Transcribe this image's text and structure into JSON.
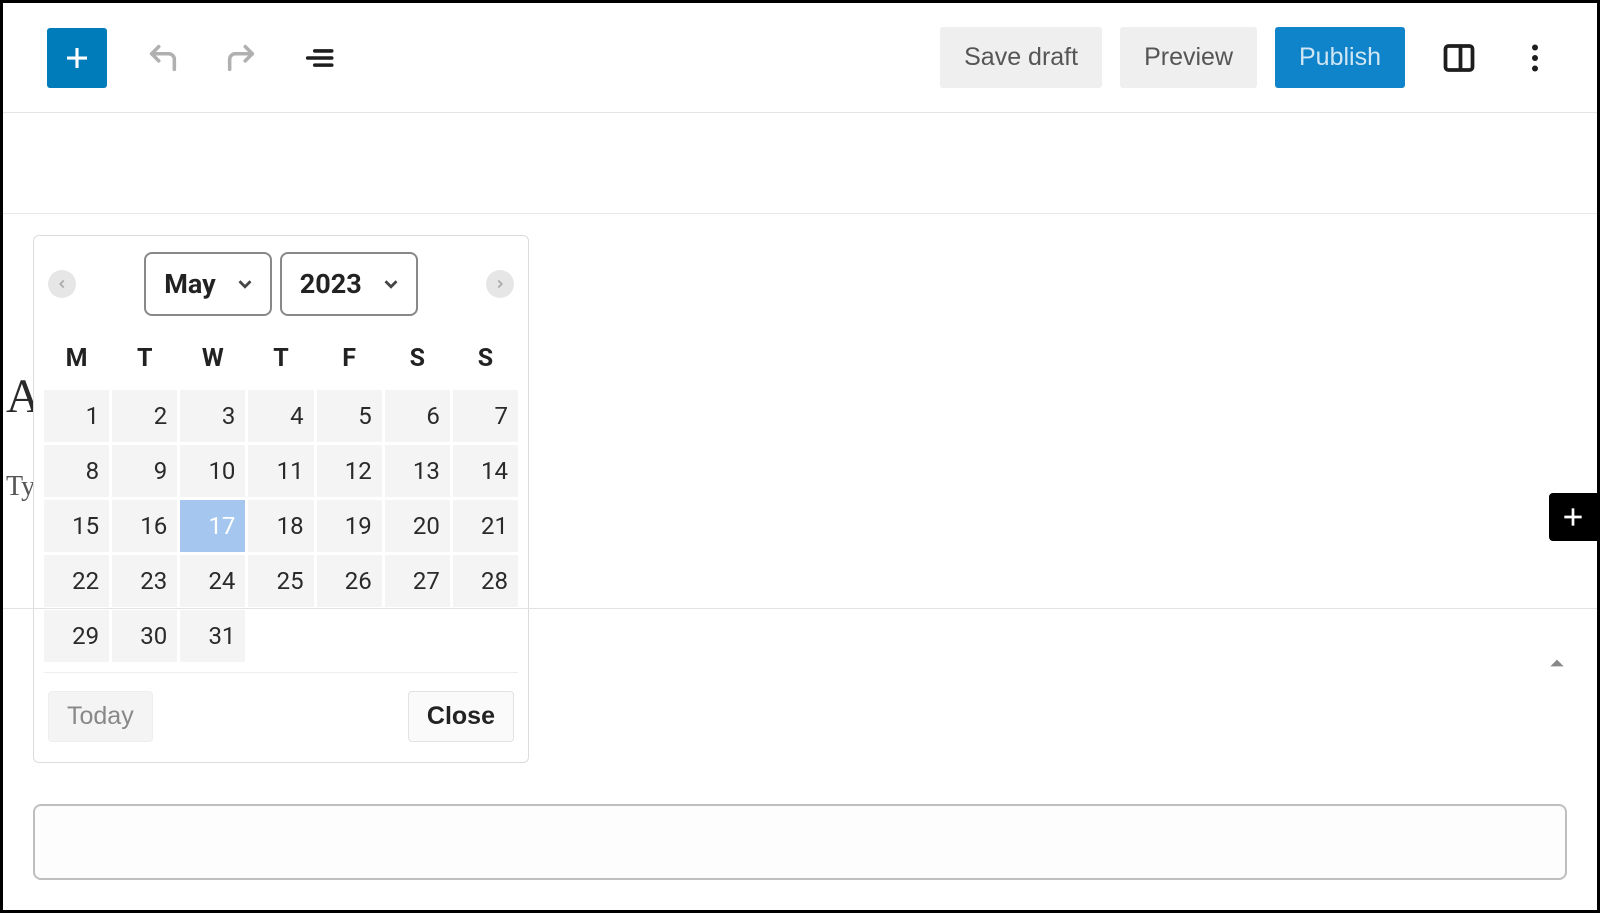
{
  "toolbar": {
    "save_draft": "Save draft",
    "preview": "Preview",
    "publish": "Publish"
  },
  "editor": {
    "title_placeholder_visible": "A",
    "body_placeholder_visible": "Ty"
  },
  "calendar": {
    "month": "May",
    "year": "2023",
    "dow": [
      "M",
      "T",
      "W",
      "T",
      "F",
      "S",
      "S"
    ],
    "weeks": [
      [
        1,
        2,
        3,
        4,
        5,
        6,
        7
      ],
      [
        8,
        9,
        10,
        11,
        12,
        13,
        14
      ],
      [
        15,
        16,
        17,
        18,
        19,
        20,
        21
      ],
      [
        22,
        23,
        24,
        25,
        26,
        27,
        28
      ],
      [
        29,
        30,
        31,
        null,
        null,
        null,
        null
      ]
    ],
    "selected_day": 17,
    "today_label": "Today",
    "close_label": "Close"
  }
}
